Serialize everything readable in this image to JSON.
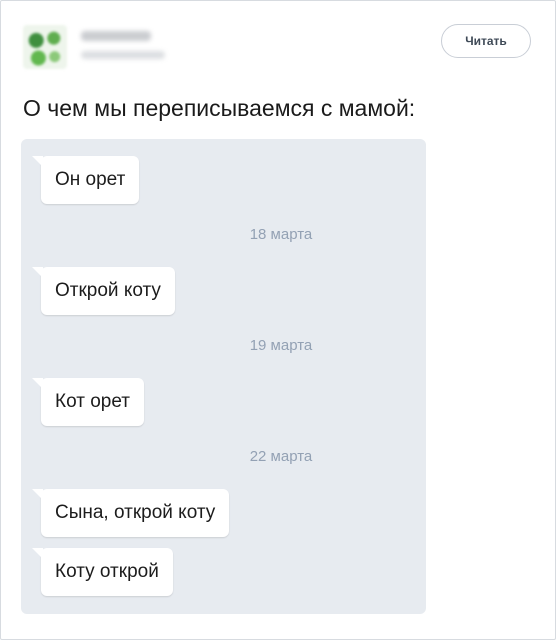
{
  "header": {
    "read_button_label": "Читать"
  },
  "post": {
    "title": "О чем мы переписываемся с мамой:"
  },
  "chat": {
    "messages": [
      {
        "text": "Он орет"
      },
      {
        "date": "18 марта"
      },
      {
        "text": "Открой коту"
      },
      {
        "date": "19 марта"
      },
      {
        "text": "Кот орет"
      },
      {
        "date": "22 марта"
      },
      {
        "text": "Сына, открой коту"
      },
      {
        "text": "Коту открой"
      }
    ]
  },
  "colors": {
    "chat_background": "#e7ebf0",
    "bubble": "#ffffff",
    "date_text": "#93a1b4",
    "button_border": "#c9ced6"
  }
}
